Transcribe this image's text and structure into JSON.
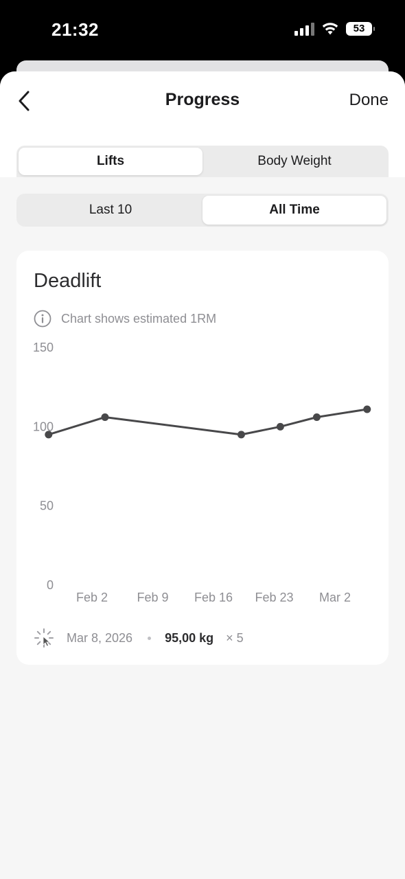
{
  "status_bar": {
    "time": "21:32",
    "battery": "53"
  },
  "nav": {
    "title": "Progress",
    "done_label": "Done"
  },
  "category_tabs": [
    {
      "label": "Lifts",
      "active": true
    },
    {
      "label": "Body Weight",
      "active": false
    }
  ],
  "period_tabs": [
    {
      "label": "Last 10",
      "active": false
    },
    {
      "label": "All Time",
      "active": true
    }
  ],
  "card": {
    "title": "Deadlift",
    "info_text": "Chart shows estimated 1RM",
    "selected": {
      "date": "Mar 8, 2026",
      "weight": "95,00 kg",
      "reps": "× 5"
    }
  },
  "chart_data": {
    "type": "line",
    "title": "Deadlift",
    "xlabel": "",
    "ylabel": "",
    "ylim": [
      0,
      150
    ],
    "yticks": [
      0,
      50,
      100,
      150
    ],
    "x_tick_labels": [
      {
        "label": "Feb 2",
        "day": 2
      },
      {
        "label": "Feb 9",
        "day": 9
      },
      {
        "label": "Feb 16",
        "day": 16
      },
      {
        "label": "Feb 23",
        "day": 23
      },
      {
        "label": "Mar 2",
        "day": 30
      }
    ],
    "series": [
      {
        "points": [
          {
            "date": "Jan 29",
            "day": -3,
            "y": 95
          },
          {
            "date": "Feb 5",
            "day": 3.5,
            "y": 106
          },
          {
            "date": "Feb 21",
            "day": 19.2,
            "y": 95
          },
          {
            "date": "Feb 25",
            "day": 23.7,
            "y": 100
          },
          {
            "date": "Mar 1",
            "day": 27.9,
            "y": 106
          },
          {
            "date": "Mar 8",
            "day": 33.7,
            "y": 111
          }
        ]
      }
    ],
    "grid": false,
    "line_color": "#48484a"
  }
}
